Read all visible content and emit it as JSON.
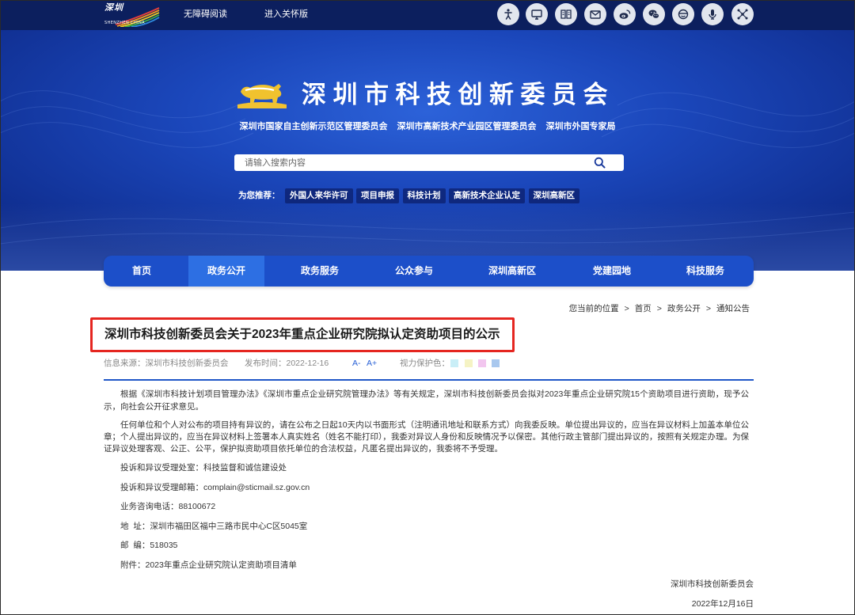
{
  "topbar": {
    "logo": {
      "cn": "深圳",
      "en": "SHENZHEN CHINA"
    },
    "links": [
      "无障碍阅读",
      "进入关怀版"
    ],
    "icons": [
      "accessibility-icon",
      "monitor-icon",
      "reader-icon",
      "mail-icon",
      "weibo-icon",
      "wechat-icon",
      "news-icon",
      "microphone-icon",
      "network-icon"
    ]
  },
  "header": {
    "title": "深圳市科技创新委员会",
    "subtitles": [
      "深圳市国家自主创新示范区管理委员会",
      "深圳市高新技术产业园区管理委员会",
      "深圳市外国专家局"
    ],
    "search": {
      "placeholder": "请输入搜索内容"
    },
    "recommend": {
      "label": "为您推荐：",
      "tags": [
        "外国人来华许可",
        "项目申报",
        "科技计划",
        "高新技术企业认定",
        "深圳高新区"
      ]
    }
  },
  "nav": {
    "items": [
      "首页",
      "政务公开",
      "政务服务",
      "公众参与",
      "深圳高新区",
      "党建园地",
      "科技服务"
    ],
    "active_index": 1
  },
  "breadcrumb": {
    "label": "您当前的位置",
    "separator": ">",
    "items": [
      "首页",
      "政务公开",
      "通知公告"
    ]
  },
  "article": {
    "title": "深圳市科技创新委员会关于2023年重点企业研究院拟认定资助项目的公示",
    "source_label": "信息来源：",
    "source": "深圳市科技创新委员会",
    "date_label": "发布时间：",
    "date": "2022-12-16",
    "font_smaller": "A-",
    "font_larger": "A+",
    "eye_care_label": "视力保护色：",
    "eye_care_colors": [
      "#c9eef7",
      "#f5f3c4",
      "#f2c6ef",
      "#a9c8ee"
    ],
    "paragraphs": [
      "根据《深圳市科技计划项目管理办法》《深圳市重点企业研究院管理办法》等有关规定，深圳市科技创新委员会拟对2023年重点企业研究院15个资助项目进行资助，现予公示，向社会公开征求意见。",
      "任何单位和个人对公布的项目持有异议的，请在公布之日起10天内以书面形式（注明通讯地址和联系方式）向我委反映。单位提出异议的，应当在异议材料上加盖本单位公章；个人提出异议的，应当在异议材料上签署本人真实姓名（姓名不能打印），我委对异议人身份和反映情况予以保密。其他行政主管部门提出异议的，按照有关规定办理。为保证异议处理客观、公正、公平，保护拟资助项目依托单位的合法权益，凡匿名提出异议的，我委将不予受理。"
    ],
    "lines": [
      "投诉和异议受理处室：科技监督和诚信建设处",
      "投诉和异议受理邮箱：complain@sticmail.sz.gov.cn",
      "业务咨询电话：88100672",
      "地  址：深圳市福田区福中三路市民中心C区5045室",
      "邮  编：518035",
      "附件：2023年重点企业研究院认定资助项目清单"
    ],
    "signature": {
      "org": "深圳市科技创新委员会",
      "date": "2022年12月16日"
    }
  },
  "colors": {
    "topbar": "#0c1f5e",
    "nav": "#1c4fc9",
    "nav_active": "#2d6fe3",
    "accent_rule": "#1f57c8",
    "highlight_box": "#e52620"
  }
}
